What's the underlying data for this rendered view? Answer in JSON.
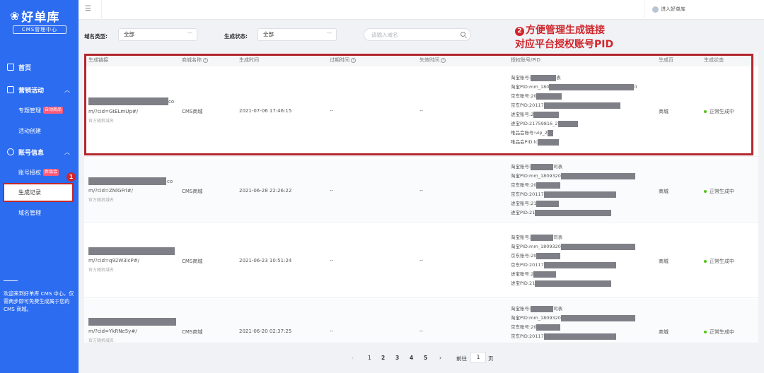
{
  "app": {
    "logo_text": "好单库",
    "logo_subtitle": "CMS管理中心"
  },
  "sidebar": {
    "home": "首页",
    "marketing": "营销活动",
    "topic_manage": "专题管理",
    "topic_badge": "自动商品",
    "activity_create": "活动创建",
    "account_info": "账号信息",
    "account_auth": "账号授权",
    "account_badge": "新品会",
    "generate_records": "生成记录",
    "domain_manage": "域名管理",
    "welcome_text": "欢迎来到好单库 CMS 中心，仅需两步即可免费生成属于您的 CMS 商城。",
    "annotation_1": "1"
  },
  "topbar": {
    "enter_label": "进入好单库"
  },
  "filters": {
    "domain_type_label": "域名类型:",
    "domain_type_value": "全部",
    "gen_status_label": "生成状态:",
    "gen_status_value": "全部",
    "search_placeholder": "请输入域名"
  },
  "annotation_2": {
    "num": "2",
    "line1": "方便管理生成链接",
    "line2": "对应平台授权账号PID"
  },
  "table": {
    "headers": {
      "link": "生成链接",
      "shop_name": "商城名称",
      "gen_time": "生成时间",
      "expire_time": "过期时间",
      "invalid_time": "失效时间",
      "account": "授权账号/PID",
      "page": "生成页",
      "status": "生成状态"
    },
    "rows": [
      {
        "link_suffix": "co",
        "link_cid": "m/?cid=GtELmUp#/",
        "source": "官方随机域名",
        "shop": "CMS商城",
        "time": "2021-07-06 17:46:15",
        "expire": "--",
        "invalid": "--",
        "acc1_label": "淘宝账号:",
        "acc1_suffix": "表",
        "acc2_label": "淘宝PID:",
        "acc2_prefix": "mm_180",
        "acc2_suffix": "0",
        "acc3_label": "京东账号:",
        "acc3_prefix": "20",
        "acc4_label": "京东PID:",
        "acc4_prefix": "20117",
        "acc5_label": "进宝账号:",
        "acc5_prefix": "2",
        "acc6_label": "进宝PID:",
        "acc6_prefix": "21759816_2",
        "acc7_label": "唯品会账号:",
        "acc7_prefix": "vip_2",
        "acc8_label": "唯品会PID:",
        "acc8_prefix": "lc",
        "page": "商城",
        "status": "正常生成中"
      },
      {
        "link_suffix": "co",
        "link_cid": "m/?cid=ZNlGFrl#/",
        "source": "官方随机域名",
        "shop": "CMS商城",
        "time": "2021-06-28 22:26:22",
        "expire": "--",
        "invalid": "--",
        "acc1_label": "淘宝账号:",
        "acc1_suffix": "司表",
        "acc2_label": "淘宝PID:",
        "acc2_prefix": "mm_1809320",
        "acc3_label": "京东账号:",
        "acc3_prefix": "20",
        "acc4_label": "京东PID:",
        "acc4_prefix": "20117",
        "acc5_label": "进宝账号:",
        "acc5_prefix": "21",
        "acc6_label": "进宝PID:",
        "acc6_prefix": "21",
        "page": "商城",
        "status": "正常生成中"
      },
      {
        "link_cid": "m/?cid=q92W3lcP#/",
        "source": "官方随机域名",
        "shop": "CMS商城",
        "time": "2021-06-23 10:51:24",
        "expire": "--",
        "invalid": "--",
        "acc1_label": "淘宝账号:",
        "acc1_suffix": "司表",
        "acc2_label": "淘宝PID:",
        "acc2_prefix": "mm_1809320",
        "acc3_label": "京东账号:",
        "acc3_prefix": "20",
        "acc4_label": "京东PID:",
        "acc4_prefix": "20117",
        "acc5_label": "进宝账号:",
        "acc5_prefix": "2",
        "acc6_label": "进宝PID:",
        "acc6_prefix": "21",
        "page": "商城",
        "status": "正常生成中"
      },
      {
        "link_cid": "m/?cid=YkRNe5y#/",
        "source": "官方随机域名",
        "shop": "CMS商城",
        "time": "2021-06-20 02:37:25",
        "expire": "--",
        "invalid": "--",
        "acc1_label": "淘宝账号:",
        "acc1_suffix": "司表",
        "acc2_label": "淘宝PID:",
        "acc2_prefix": "mm_1809320",
        "acc3_label": "京东账号:",
        "acc3_prefix": "20",
        "acc4_label": "京东PID:",
        "acc4_prefix": "20117",
        "page": "商城",
        "status": "正常生成中"
      }
    ]
  },
  "pagination": {
    "prev": "‹",
    "p1": "1",
    "p2": "2",
    "p3": "3",
    "p4": "4",
    "p5": "5",
    "next": "›",
    "goto_label": "前往",
    "goto_value": "1",
    "page_unit": "页"
  },
  "colors": {
    "sidebar_bg": "#2c6cf0",
    "annotation_red": "#d0252b",
    "status_green": "#52c41a"
  },
  "icons": {
    "menu": "hamburger-icon",
    "search": "search-icon",
    "user": "user-icon",
    "home": "home-icon",
    "marketing": "calendar-icon",
    "account": "settings-icon"
  }
}
